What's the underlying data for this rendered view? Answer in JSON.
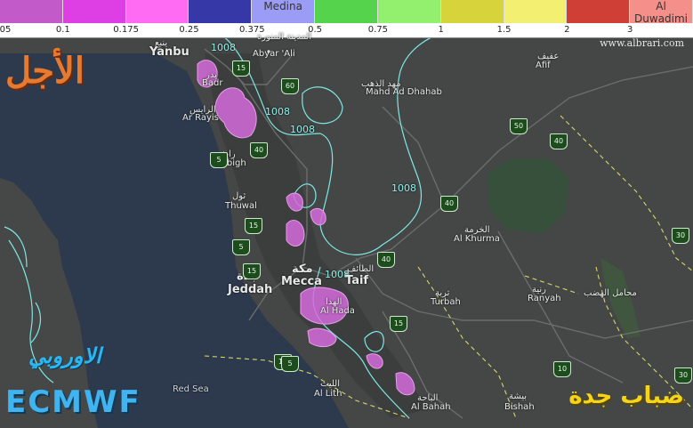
{
  "legend": {
    "swatches": [
      {
        "color": "#c25ac9",
        "label": ""
      },
      {
        "color": "#de3fe4",
        "label": ""
      },
      {
        "color": "#ff6cf3",
        "label": ""
      },
      {
        "color": "#3638a8",
        "label": ""
      },
      {
        "color": "#9a9cf5",
        "label": "Medina"
      },
      {
        "color": "#55d34d",
        "label": ""
      },
      {
        "color": "#93f06e",
        "label": ""
      },
      {
        "color": "#d6d33b",
        "label": ""
      },
      {
        "color": "#f3ef71",
        "label": ""
      },
      {
        "color": "#d03f36",
        "label": ""
      },
      {
        "color": "#f58f8a",
        "label": "Al Duwadimi"
      }
    ],
    "ticks": [
      "05",
      "0.1",
      "0.175",
      "0.25",
      "0.375",
      "0.5",
      "0.75",
      "1",
      "1.5",
      "2",
      "3"
    ]
  },
  "branding": {
    "site": "www.albrari.com",
    "title_ar": "الأجل",
    "model_ar": "الاوروبي",
    "model": "ECMWF",
    "product_ar": "ضباب جدة"
  },
  "isobar_labels": [
    "1008",
    "1008",
    "1008",
    "1008",
    "1008"
  ],
  "places": [
    {
      "id": "yanbu",
      "ar": "ينبع",
      "en": "Yanbu"
    },
    {
      "id": "abyar",
      "ar": "أبيار علي",
      "en": "Abyar 'Ali"
    },
    {
      "id": "medina_ar",
      "ar": "المدينة المنورة",
      "en": ""
    },
    {
      "id": "badr",
      "ar": "بدر",
      "en": "Badr"
    },
    {
      "id": "rayis",
      "ar": "الرايس",
      "en": "Ar Rayis"
    },
    {
      "id": "mahd",
      "ar": "مهد الذهب",
      "en": "Mahd Ad Dhahab"
    },
    {
      "id": "afif",
      "ar": "عفيف",
      "en": "Afif"
    },
    {
      "id": "rabigh",
      "ar": "رابغ",
      "en": "Rabigh"
    },
    {
      "id": "thuwal",
      "ar": "ثول",
      "en": "Thuwal"
    },
    {
      "id": "khurma",
      "ar": "الخرمة",
      "en": "Al Khurma"
    },
    {
      "id": "mecca",
      "ar": "مكة",
      "en": "Mecca"
    },
    {
      "id": "taif",
      "ar": "الطائف",
      "en": "Taif"
    },
    {
      "id": "jeddah",
      "ar": "جدة",
      "en": "Jeddah"
    },
    {
      "id": "turbah",
      "ar": "تربة",
      "en": "Turbah"
    },
    {
      "id": "ranyah",
      "ar": "رنية",
      "en": "Ranyah"
    },
    {
      "id": "hada",
      "ar": "الهدا",
      "en": "Al Hada"
    },
    {
      "id": "lith",
      "ar": "الليث",
      "en": "Al Lith"
    },
    {
      "id": "bahah",
      "ar": "الباحة",
      "en": "Al Bahah"
    },
    {
      "id": "bishah",
      "ar": "بيشة",
      "en": "Bishah"
    },
    {
      "id": "mahamil",
      "ar": "محامل الهضب",
      "en": ""
    }
  ],
  "sea_label": "Red Sea",
  "road_shields": [
    "15",
    "60",
    "50",
    "40",
    "40",
    "40",
    "15",
    "5",
    "40",
    "15",
    "10",
    "30",
    "30",
    "15",
    "5",
    "5",
    "15"
  ]
}
